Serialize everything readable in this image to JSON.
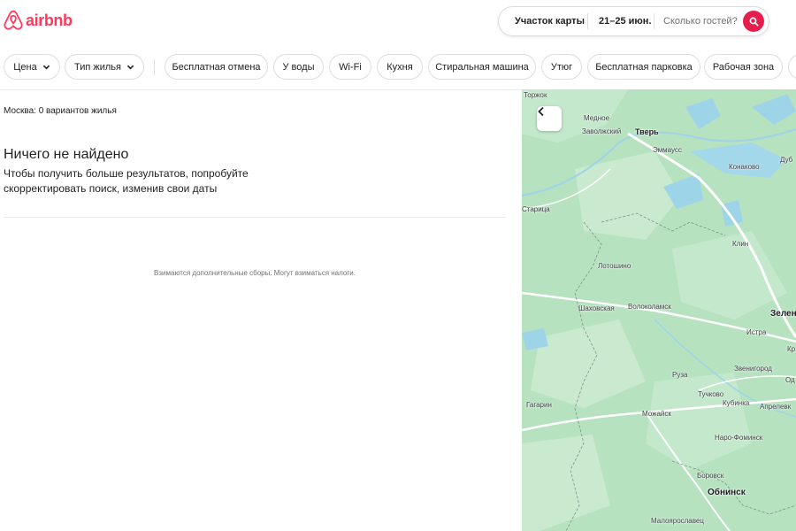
{
  "brand": {
    "name": "airbnb",
    "color": "#ff385c"
  },
  "search": {
    "area": "Участок карты",
    "dates": "21–25 июн.",
    "guests_placeholder": "Сколько гостей?",
    "button_icon": "search-icon"
  },
  "filters": {
    "price": "Цена",
    "type": "Тип жилья",
    "chips": [
      "Бесплатная отмена",
      "У воды",
      "Wi-Fi",
      "Кухня",
      "Стиральная машина",
      "Утюг",
      "Бесплатная парковка",
      "Рабочая зона"
    ]
  },
  "results": {
    "count_text": "Москва: 0 вариантов жилья",
    "empty_title": "Ничего не найдено",
    "empty_text": "Чтобы получить больше результатов, попробуйте скорректировать поиск, изменив свои даты",
    "fees_note": "Взимаются дополнительные сборы. Могут взиматься налоги."
  },
  "map": {
    "collapse_icon": "chevron-left-icon",
    "labels": {
      "torzhok": "Торжок",
      "mednoe": "Медное",
      "zavolzhsky": "Заволжский",
      "tver": "Тверь",
      "emmauss": "Эммаусс",
      "konakovo": "Конаково",
      "dubna": "Дуб",
      "staritsa": "Старица",
      "klin": "Клин",
      "lotoshino": "Лотошино",
      "shakhovskaya": "Шаховская",
      "volokolamsk": "Волоколамск",
      "zelenograd": "Зелен",
      "istra": "Истра",
      "kr": "Кр",
      "zvenigorod": "Звенигород",
      "od": "Од",
      "ruza": "Руза",
      "tuchkovo": "Тучково",
      "kubinka": "Кубинка",
      "aprelevka": "Апрелевк",
      "gagarin": "Гагарин",
      "mozhaysk": "Можайск",
      "naro_fominsk": "Наро-Фоминск",
      "borovsk": "Боровск",
      "obninsk": "Обнинск",
      "maloyaroslavets": "Малоярославец"
    }
  }
}
